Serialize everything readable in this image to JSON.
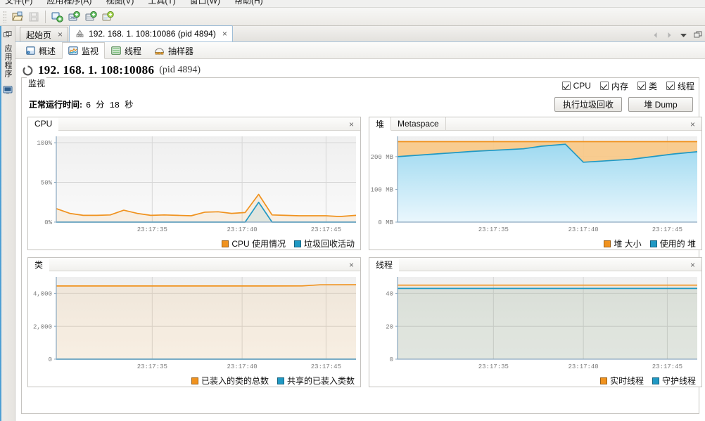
{
  "window": {
    "menu": [
      {
        "label": "文件(F)"
      },
      {
        "label": "应用程序(A)"
      },
      {
        "label": "视图(V)"
      },
      {
        "label": "工具(T)"
      },
      {
        "label": "窗口(W)"
      },
      {
        "label": "帮助(H)"
      }
    ]
  },
  "toolbar": {
    "buttons": [
      {
        "name": "open-file-icon",
        "title": "打开"
      },
      {
        "name": "save-icon",
        "title": "保存"
      },
      {
        "name": "add-application-icon",
        "title": "添加应用程序"
      },
      {
        "name": "add-jmx-connection-icon",
        "title": "添加 JMX 连接"
      },
      {
        "name": "add-remote-host-icon",
        "title": "添加远程主机"
      },
      {
        "name": "add-snapshot-icon",
        "title": "添加快照"
      }
    ]
  },
  "leftdock": {
    "label": "应用程序",
    "icons": [
      "float-window-icon",
      "monitor-icon"
    ]
  },
  "tabstrip": {
    "tabs": [
      {
        "label": "起始页",
        "icon": "none",
        "active": false,
        "close": "×"
      },
      {
        "label": "192. 168. 1. 108:10086 (pid 4894)",
        "icon": "jmx-icon",
        "active": true,
        "close": "×"
      }
    ],
    "controls": [
      "scroll-left-icon",
      "scroll-right-icon",
      "tab-list-icon",
      "maximize-icon"
    ]
  },
  "subtabs": [
    {
      "label": "概述",
      "icon": "overview-icon",
      "active": false
    },
    {
      "label": "监视",
      "icon": "monitor-chart-icon",
      "active": true
    },
    {
      "label": "线程",
      "icon": "threads-icon",
      "active": false
    },
    {
      "label": "抽样器",
      "icon": "sampler-icon",
      "active": false
    }
  ],
  "header": {
    "icon": "loading-spinner-icon",
    "title": "192. 168. 1. 108:10086",
    "pid": "(pid 4894)"
  },
  "monitor": {
    "group_title": "监视",
    "checkboxes": [
      {
        "label": "CPU",
        "checked": true
      },
      {
        "label": "内存",
        "checked": true
      },
      {
        "label": "类",
        "checked": true
      },
      {
        "label": "线程",
        "checked": true
      }
    ],
    "uptime_label": "正常运行时间:",
    "uptime_value": "6 分 18 秒",
    "buttons": [
      {
        "label": "执行垃圾回收"
      },
      {
        "label": "堆 Dump"
      }
    ]
  },
  "colors": {
    "orange": "#F0921E",
    "orange_fill": "#F8C98A",
    "blue": "#2099C4",
    "blue_fill": "#ADE0F2",
    "plot_bg_top": "#EFEFEF",
    "plot_bg_bottom": "#FAFAFA",
    "grid": "#D7D7D7",
    "axis": "#8AA8C0"
  },
  "chart_data": [
    {
      "id": "cpu",
      "type": "line",
      "title": "CPU",
      "tabs": [
        {
          "label": "CPU",
          "active": true
        }
      ],
      "close_icon": "×",
      "ylabel": "",
      "xlabel": "",
      "yticks": [
        "0%",
        "50%",
        "100%"
      ],
      "ytick_values": [
        0,
        50,
        100
      ],
      "ylim": [
        0,
        108
      ],
      "xticks": [
        "23:17:35",
        "23:17:40",
        "23:17:45"
      ],
      "xtick_positions": [
        0.32,
        0.62,
        0.9
      ],
      "legend": [
        {
          "name": "CPU 使用情况",
          "color": "#F0921E"
        },
        {
          "name": "垃圾回收活动",
          "color": "#2099C4"
        }
      ],
      "series": [
        {
          "name": "CPU 使用情况",
          "color": "#F0921E",
          "x": [
            0.0,
            0.045,
            0.09,
            0.135,
            0.18,
            0.225,
            0.27,
            0.315,
            0.36,
            0.405,
            0.45,
            0.495,
            0.54,
            0.585,
            0.63,
            0.675,
            0.72,
            0.765,
            0.81,
            0.855,
            0.9,
            0.945,
            1.0
          ],
          "values": [
            17,
            11,
            8.5,
            8.5,
            9,
            15,
            11,
            8.5,
            9,
            8.5,
            8,
            12.5,
            13,
            11,
            12,
            35,
            9,
            8.5,
            8,
            8,
            8,
            7,
            8.5
          ]
        },
        {
          "name": "垃圾回收活动",
          "color": "#2099C4",
          "x": [
            0.0,
            0.045,
            0.09,
            0.135,
            0.18,
            0.225,
            0.27,
            0.315,
            0.36,
            0.405,
            0.45,
            0.495,
            0.54,
            0.585,
            0.63,
            0.675,
            0.72,
            0.765,
            0.81,
            0.855,
            0.9,
            0.945,
            1.0
          ],
          "values": [
            0,
            0,
            0,
            0,
            0,
            0,
            0,
            0,
            0,
            0,
            0,
            0,
            0,
            0,
            0,
            25,
            0,
            0,
            0,
            0,
            0,
            0,
            0
          ]
        }
      ]
    },
    {
      "id": "heap",
      "type": "area",
      "title": "堆",
      "tabs": [
        {
          "label": "堆",
          "active": true
        },
        {
          "label": "Metaspace",
          "active": false
        }
      ],
      "close_icon": "×",
      "yticks": [
        "0 MB",
        "100 MB",
        "200 MB"
      ],
      "ytick_values": [
        0,
        100,
        200
      ],
      "ylim": [
        0,
        262
      ],
      "xticks": [
        "23:17:35",
        "23:17:40",
        "23:17:45"
      ],
      "xtick_positions": [
        0.32,
        0.62,
        0.9
      ],
      "legend": [
        {
          "name": "堆 大小",
          "color": "#F0921E"
        },
        {
          "name": "使用的 堆",
          "color": "#2099C4"
        }
      ],
      "series": [
        {
          "name": "堆 大小",
          "color": "#F0921E",
          "fill": "#F8C98A",
          "x": [
            0.0,
            0.25,
            0.48,
            0.56,
            0.7,
            0.85,
            1.0
          ],
          "values": [
            246,
            246,
            246,
            246,
            246,
            246,
            246
          ]
        },
        {
          "name": "使用的 堆",
          "color": "#2099C4",
          "fill": "#ADE0F2",
          "x": [
            0.0,
            0.25,
            0.42,
            0.48,
            0.56,
            0.62,
            0.78,
            0.92,
            1.0
          ],
          "values": [
            200,
            216,
            224,
            232,
            238,
            183,
            192,
            208,
            215
          ]
        }
      ]
    },
    {
      "id": "classes",
      "type": "line",
      "title": "类",
      "tabs": [
        {
          "label": "类",
          "active": true
        }
      ],
      "close_icon": "×",
      "yticks": [
        "0",
        "2,000",
        "4,000"
      ],
      "ytick_values": [
        0,
        2000,
        4000
      ],
      "ylim": [
        0,
        5000
      ],
      "xticks": [
        "23:17:35",
        "23:17:40",
        "23:17:45"
      ],
      "xtick_positions": [
        0.32,
        0.62,
        0.9
      ],
      "legend": [
        {
          "name": "已装入的类的总数",
          "color": "#F0921E"
        },
        {
          "name": "共享的已装入类数",
          "color": "#2099C4"
        }
      ],
      "series": [
        {
          "name": "已装入的类的总数",
          "color": "#F0921E",
          "x": [
            0.0,
            0.3,
            0.6,
            0.82,
            0.88,
            1.0
          ],
          "values": [
            4450,
            4450,
            4450,
            4455,
            4520,
            4525
          ]
        },
        {
          "name": "共享的已装入类数",
          "color": "#2099C4",
          "x": [
            0.0,
            1.0
          ],
          "values": [
            0,
            0
          ]
        }
      ]
    },
    {
      "id": "threads",
      "type": "line",
      "title": "线程",
      "tabs": [
        {
          "label": "线程",
          "active": true
        }
      ],
      "close_icon": "×",
      "yticks": [
        "0",
        "20",
        "40"
      ],
      "ytick_values": [
        0,
        20,
        40
      ],
      "ylim": [
        0,
        50
      ],
      "xticks": [
        "23:17:35",
        "23:17:40",
        "23:17:45"
      ],
      "xtick_positions": [
        0.32,
        0.62,
        0.9
      ],
      "legend": [
        {
          "name": "实时线程",
          "color": "#F0921E"
        },
        {
          "name": "守护线程",
          "color": "#2099C4"
        }
      ],
      "series": [
        {
          "name": "实时线程",
          "color": "#F0921E",
          "x": [
            0.0,
            1.0
          ],
          "values": [
            45,
            45
          ]
        },
        {
          "name": "守护线程",
          "color": "#2099C4",
          "x": [
            0.0,
            1.0
          ],
          "values": [
            43,
            43
          ]
        }
      ]
    }
  ]
}
